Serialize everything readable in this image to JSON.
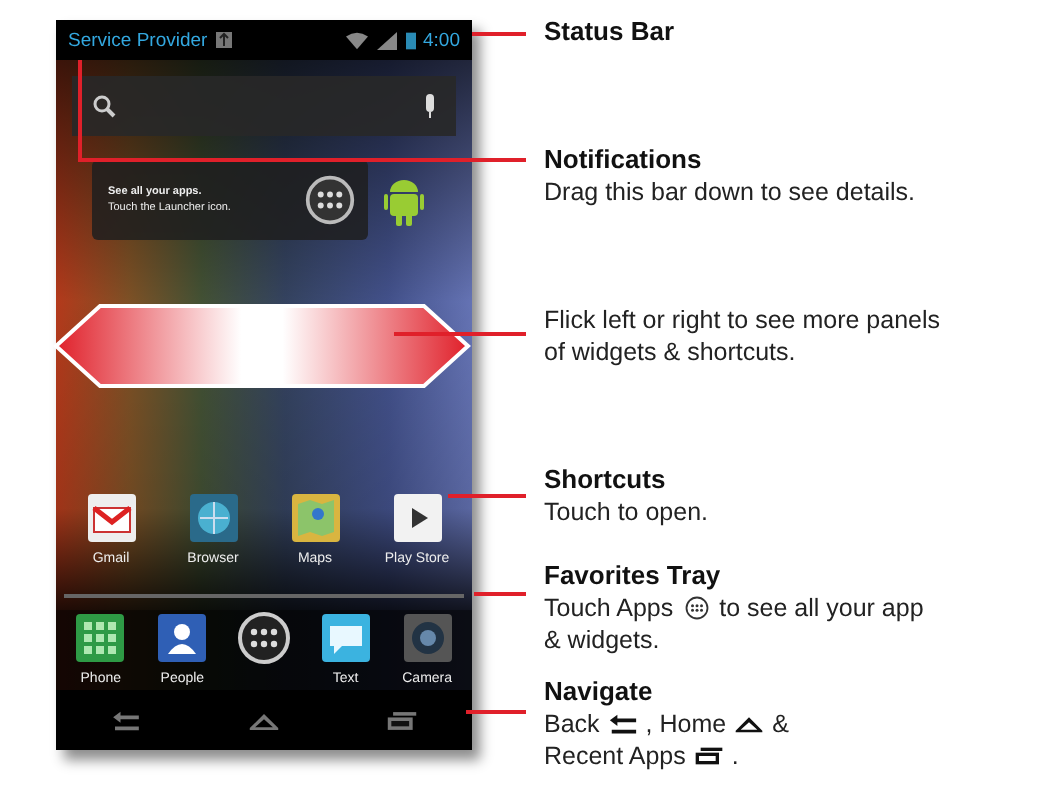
{
  "status_bar": {
    "carrier": "Service Provider",
    "time": "4:00"
  },
  "widget": {
    "lines": [
      "See all your apps.",
      "Touch the Launcher icon."
    ]
  },
  "shortcuts": [
    {
      "label": "Gmail",
      "kind": "mail"
    },
    {
      "label": "Browser",
      "kind": "browser"
    },
    {
      "label": "Maps",
      "kind": "maps"
    },
    {
      "label": "Play Store",
      "kind": "store"
    }
  ],
  "favorites": [
    {
      "label": "Phone",
      "kind": "phone"
    },
    {
      "label": "People",
      "kind": "people"
    },
    {
      "kind": "launcher"
    },
    {
      "label": "Text",
      "kind": "text"
    },
    {
      "label": "Camera",
      "kind": "camera"
    }
  ],
  "callouts": [
    {
      "title": "Status Bar"
    },
    {
      "title": "Notifications",
      "lines": [
        [
          {
            "kind": "text",
            "text": "Drag this bar down to see details."
          }
        ]
      ]
    },
    {
      "lines": [
        [
          {
            "kind": "text",
            "text": "Flick left or right to see more panels"
          }
        ],
        [
          {
            "kind": "text",
            "text": "of widgets & shortcuts."
          }
        ]
      ]
    },
    {
      "title": "Shortcuts",
      "lines": [
        [
          {
            "kind": "text",
            "text": "Touch to open."
          }
        ]
      ]
    },
    {
      "title": "Favorites Tray",
      "lines": [
        [
          {
            "kind": "text",
            "text": "Touch Apps"
          },
          {
            "kind": "apps"
          },
          {
            "kind": "text",
            "text": "to see all your app"
          }
        ],
        [
          {
            "kind": "text",
            "text": "& widgets."
          }
        ]
      ]
    },
    {
      "title": "Navigate",
      "lines": [
        [
          {
            "kind": "text",
            "text": "Back"
          },
          {
            "kind": "back"
          },
          {
            "kind": "text",
            "text": ", Home"
          },
          {
            "kind": "home"
          },
          {
            "kind": "text",
            "text": "&"
          }
        ],
        [
          {
            "kind": "text",
            "text": "Recent Apps"
          },
          {
            "kind": "recent"
          },
          {
            "kind": "text",
            "text": "."
          }
        ]
      ]
    }
  ]
}
